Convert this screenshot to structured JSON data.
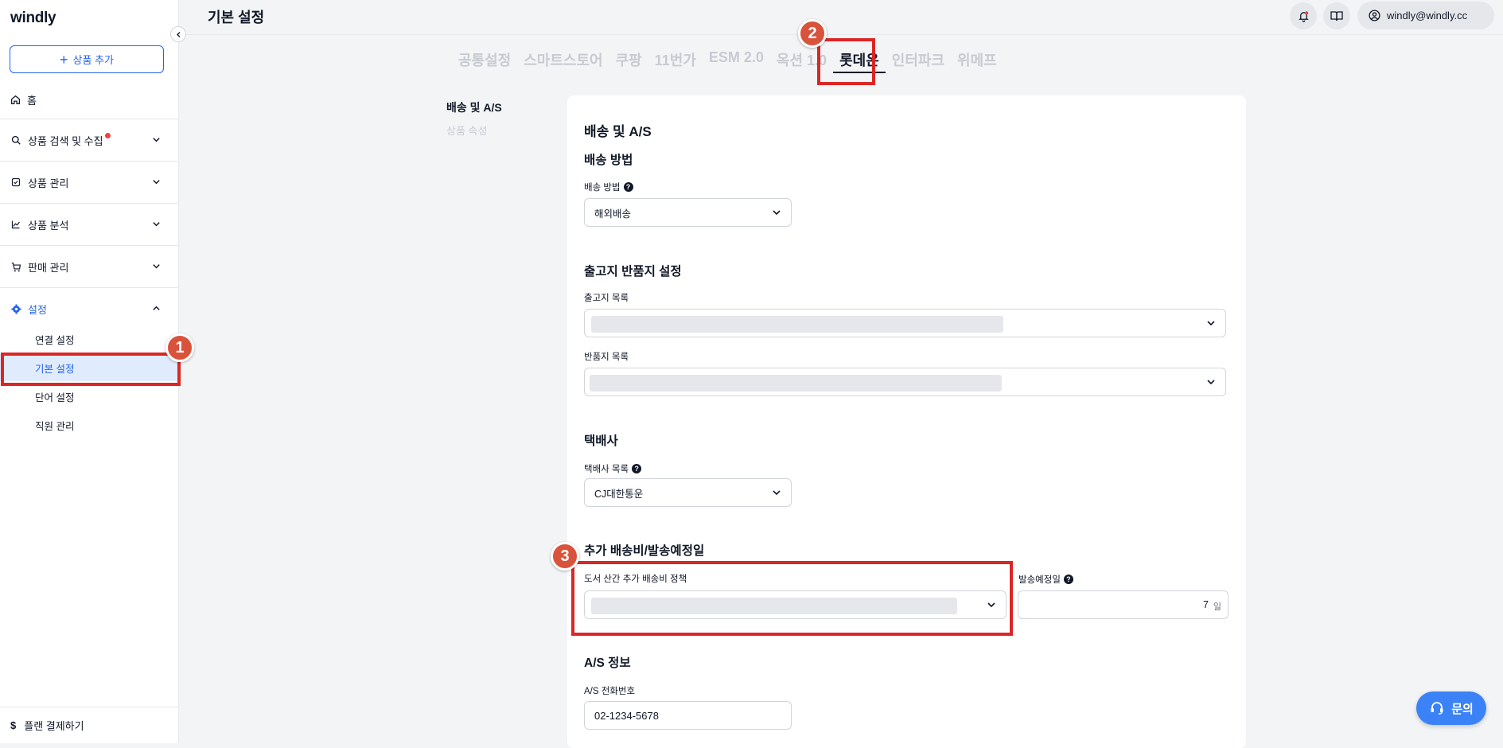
{
  "sidebar": {
    "logo": "windly",
    "add_product": "상품 추가",
    "home": "홈",
    "nav": [
      {
        "label": "상품 검색 및 수집"
      },
      {
        "label": "상품 관리"
      },
      {
        "label": "상품 분석"
      },
      {
        "label": "판매 관리"
      },
      {
        "label": "설정"
      }
    ],
    "settings_items": [
      "연결 설정",
      "기본 설정",
      "단어 설정",
      "직원 관리"
    ],
    "plan": "플랜 결제하기"
  },
  "header": {
    "title": "기본 설정",
    "user_email": "windly@windly.cc"
  },
  "tabs": [
    "공통설정",
    "스마트스토어",
    "쿠팡",
    "11번가",
    "ESM 2.0",
    "옥션 1.0",
    "롯데온",
    "인터파크",
    "위메프"
  ],
  "active_tab": "롯데온",
  "section_nav": [
    "배송 및 A/S",
    "상품 속성"
  ],
  "form": {
    "main_heading": "배송 및 A/S",
    "shipping_method_heading": "배송 방법",
    "shipping_method_label": "배송 방법",
    "shipping_method_value": "해외배송",
    "warehouse_heading": "출고지 반품지 설정",
    "outbound_label": "출고지 목록",
    "return_label": "반품지 목록",
    "courier_heading": "택배사",
    "courier_label": "택배사 목록",
    "courier_value": "CJ대한통운",
    "extra_heading": "추가 배송비/발송예정일",
    "extra_fee_label": "도서 산간 추가 배송비 정책",
    "ship_date_label": "발송예정일",
    "ship_date_value": "7",
    "ship_date_unit": "일",
    "as_heading": "A/S 정보",
    "as_phone_label": "A/S 전화번호",
    "as_phone_value": "02-1234-5678"
  },
  "badges": [
    "1",
    "2",
    "3"
  ],
  "chat_label": "문의",
  "colors": {
    "accent": "#2563eb",
    "highlight": "#dc2626",
    "badge": "#d9533c"
  }
}
